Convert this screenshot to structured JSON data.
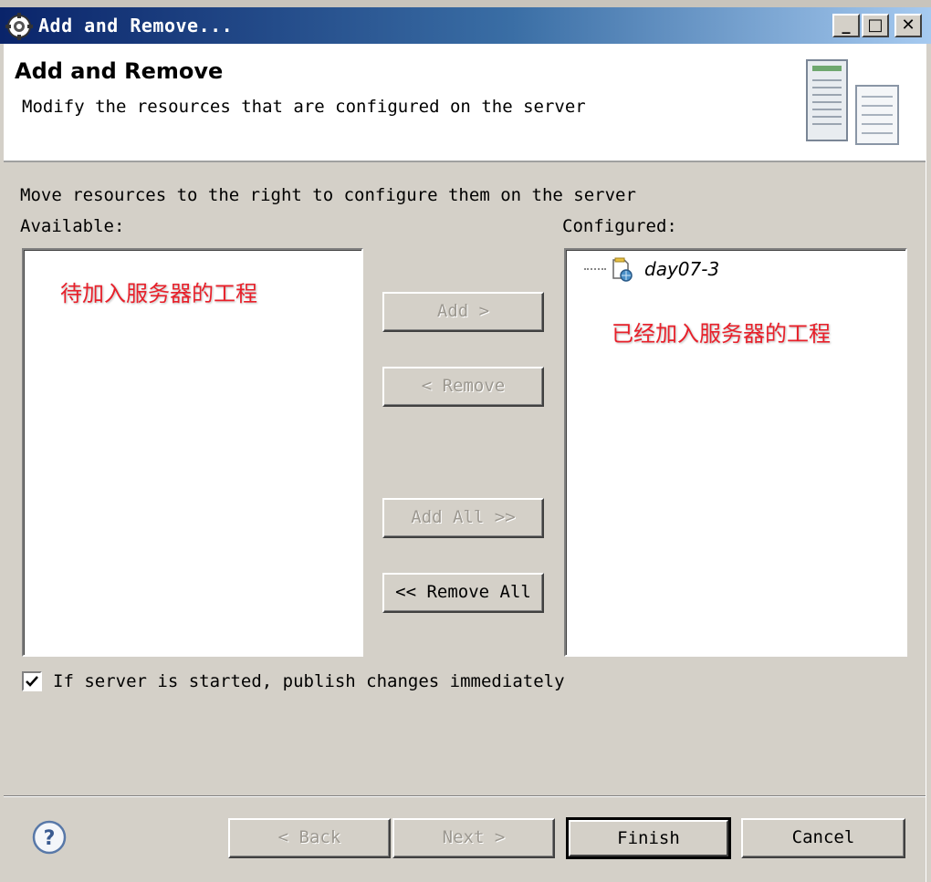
{
  "window": {
    "title": "Add and Remove...",
    "controls": [
      "minimize",
      "maximize",
      "close"
    ]
  },
  "header": {
    "title": "Add and Remove",
    "description": "Modify the resources that are configured on the server"
  },
  "body": {
    "instruction": "Move resources to the right to configure them on the server",
    "available_label": "Available:",
    "configured_label": "Configured:",
    "available_annotation": "待加入服务器的工程",
    "configured_annotation": "已经加入服务器的工程",
    "configured_items": [
      {
        "label": "day07-3",
        "icon": "web-project-icon"
      }
    ]
  },
  "buttons": {
    "add": "Add >",
    "remove": "< Remove",
    "add_all": "Add All >>",
    "remove_all": "<< Remove All"
  },
  "options": {
    "publish_label": "If server is started, publish changes immediately",
    "publish_checked": true
  },
  "footer": {
    "back": "< Back",
    "next": "Next >",
    "finish": "Finish",
    "cancel": "Cancel",
    "help_icon": "help-icon"
  },
  "colors": {
    "titlebar_start": "#0a246a",
    "titlebar_end": "#a6caf0",
    "annotation": "#e8202a",
    "dialog_bg": "#d4d0c8"
  }
}
